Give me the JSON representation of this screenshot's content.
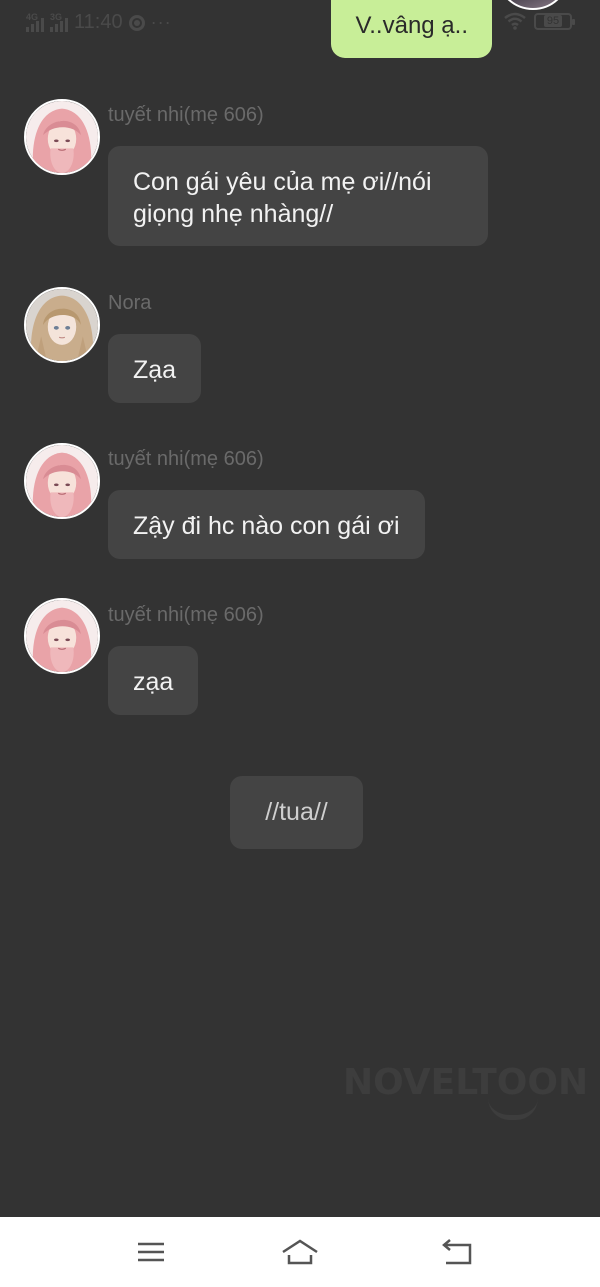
{
  "status_bar": {
    "network_1": "4G",
    "network_2": "3G",
    "time": "11:40",
    "more": "···",
    "battery": "95"
  },
  "sent_message": {
    "text": "V..vâng ạ.."
  },
  "messages": [
    {
      "sender": "tuyết nhi(mẹ 606)",
      "text": "Con gái yêu của mẹ ơi//nói giọng nhẹ nhàng//",
      "avatar": "pink-hair-avatar"
    },
    {
      "sender": "Nora",
      "text": "Zạa",
      "avatar": "blonde-hair-avatar"
    },
    {
      "sender": "tuyết nhi(mẹ 606)",
      "text": "Zậy đi hc nào con gái ơi",
      "avatar": "pink-hair-avatar"
    },
    {
      "sender": "tuyết nhi(mẹ 606)",
      "text": "zạa",
      "avatar": "pink-hair-avatar"
    }
  ],
  "narration": {
    "text": "//tua//"
  },
  "watermark": {
    "text": "NOVELTOON"
  },
  "nav_bar": {
    "menu": "menu-icon",
    "home": "home-icon",
    "back": "back-icon"
  },
  "colors": {
    "background": "#333333",
    "bubble": "#444444",
    "sent_bubble": "#c8ee98",
    "nav_bar": "#ffffff"
  }
}
